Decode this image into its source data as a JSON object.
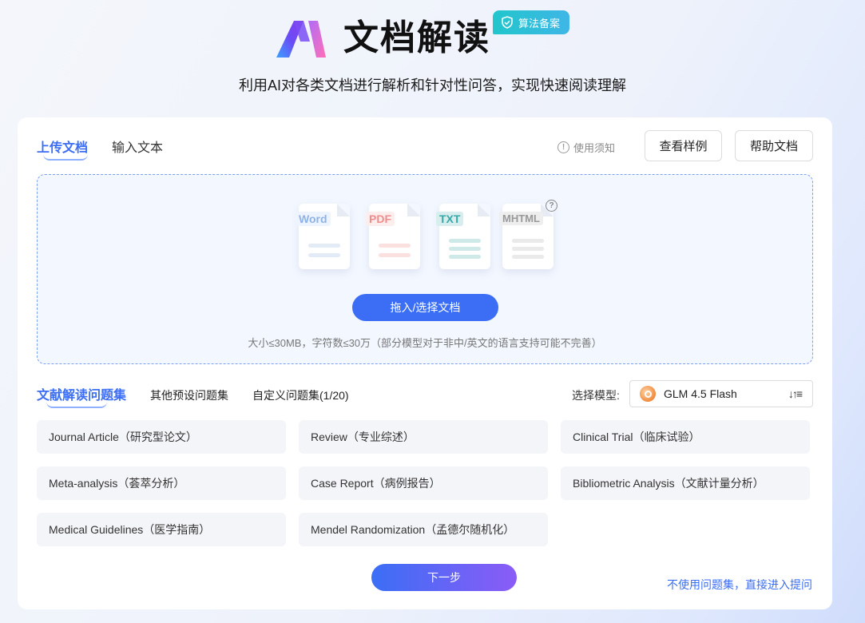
{
  "header": {
    "title": "文档解读",
    "badge": "算法备案",
    "subtitle": "利用AI对各类文档进行解析和针对性问答，实现快速阅读理解"
  },
  "tabs": [
    {
      "label": "上传文档",
      "active": true
    },
    {
      "label": "输入文本",
      "active": false
    }
  ],
  "toolbar": {
    "notice": "使用须知",
    "example_label": "查看样例",
    "help_label": "帮助文档"
  },
  "upload": {
    "file_types": [
      "Word",
      "PDF",
      "TXT",
      "MHTML"
    ],
    "button_label": "拖入/选择文档",
    "hint": "大小≤30MB，字符数≤30万（部分模型对于非中/英文的语言支持可能不完善）"
  },
  "question_tabs": [
    {
      "label": "文献解读问题集",
      "active": true
    },
    {
      "label": "其他预设问题集",
      "active": false
    },
    {
      "label": "自定义问题集(1/20)",
      "active": false
    }
  ],
  "model": {
    "label": "选择模型:",
    "selected": "GLM 4.5 Flash"
  },
  "questions": [
    "Journal Article（研究型论文）",
    "Review（专业综述）",
    "Clinical Trial（临床试验）",
    "Meta-analysis（荟萃分析）",
    "Case Report（病例报告）",
    "Bibliometric Analysis（文献计量分析）",
    "Medical Guidelines（医学指南）",
    "Mendel Randomization（孟德尔随机化）"
  ],
  "footer": {
    "next_label": "下一步",
    "skip_label": "不使用问题集，直接进入提问"
  },
  "colors": {
    "accent": "#3b6ef5",
    "badge": "#21c6cc",
    "word": "#8fb3e6",
    "pdf": "#f08c8c",
    "txt": "#3aa7a7",
    "mhtml": "#9a9a9a"
  }
}
